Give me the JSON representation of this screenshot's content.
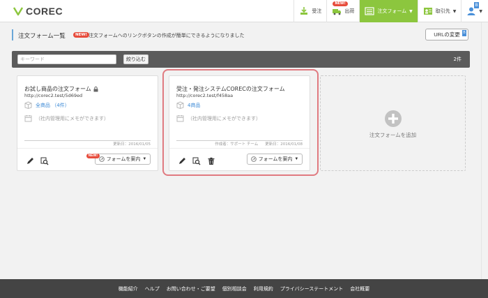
{
  "header": {
    "logo_text": "COREC",
    "nav": {
      "receive": "受注",
      "ship": "出荷",
      "ship_badge": "NEW!",
      "order_form": "注文フォーム",
      "customers": "取引先",
      "account_badge": "B"
    }
  },
  "page": {
    "title": "注文フォーム一覧",
    "new_badge": "NEW!",
    "announcement": "注文フォームへのリンクボタンの作成が簡単にできるようになりました",
    "url_change_button": "URLの変更",
    "url_change_badge": "B"
  },
  "search": {
    "placeholder": "キーワード",
    "filter_button": "絞り込む",
    "count": "2件"
  },
  "cards": [
    {
      "title": "お試し商品の注文フォーム",
      "url": "http://corec2.test/5d69ed",
      "products": "全商品 （4件）",
      "memo": "（社内管理用にメモができます）",
      "updated": "更新日：2016/01/05",
      "guide_button": "フォームを案内",
      "guide_new": "NEW!"
    },
    {
      "title": "受注・発注システムCORECの注文フォーム",
      "url": "http://corec2.test/f458aa",
      "products": "4商品",
      "memo": "（社内管理用にメモができます）",
      "creator": "作成者：サポート チーム",
      "updated": "更新日：2016/01/08",
      "guide_button": "フォームを案内"
    }
  ],
  "add_card": {
    "label": "注文フォームを追加"
  },
  "footer": {
    "links": [
      "機能紹介",
      "ヘルプ",
      "お問い合わせ・ご要望",
      "個別相談会",
      "利用規約",
      "プライバシーステートメント",
      "会社概要"
    ]
  },
  "colors": {
    "accent_green": "#8cc63e",
    "link_blue": "#3c8ad6",
    "new_red": "#e74c3c",
    "highlight": "#e07a80",
    "footer_bg": "#444444"
  }
}
